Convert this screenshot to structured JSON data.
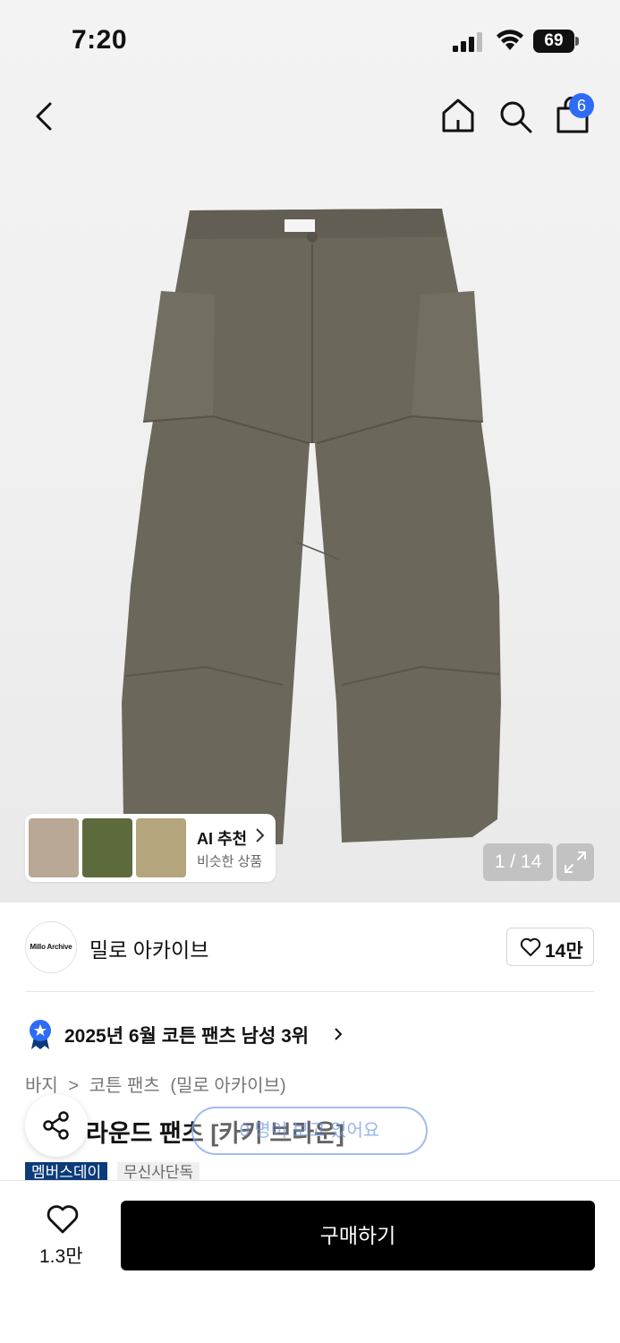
{
  "status_bar": {
    "time": "7:20",
    "battery": "69"
  },
  "nav": {
    "cart_count": "6"
  },
  "gallery": {
    "ai_recommend_title": "AI 추천",
    "ai_recommend_sub": "비슷한 상품",
    "page_indicator": "1 / 14"
  },
  "brand": {
    "logo_text": "Millo Archive",
    "name": "밀로 아카이브",
    "like_count": "14만"
  },
  "ranking": {
    "text": "2025년 6월 코튼 팬츠 남성 3위"
  },
  "breadcrumb": {
    "items": [
      "바지",
      ">",
      "코튼 팬츠",
      "(밀로 아카이브)"
    ]
  },
  "product": {
    "title": "라운드 팬츠 [카키 브라운]"
  },
  "toast": {
    "text": "0 명이 보고 있어요"
  },
  "tags": [
    "멤버스데이",
    "무신사단독"
  ],
  "bottom_bar": {
    "like_count": "1.3만",
    "buy_label": "구매하기"
  },
  "colors": {
    "accent_blue": "#2f6cf5",
    "tag_navy": "#0b3b78",
    "pants_khaki": "#6b675b"
  }
}
